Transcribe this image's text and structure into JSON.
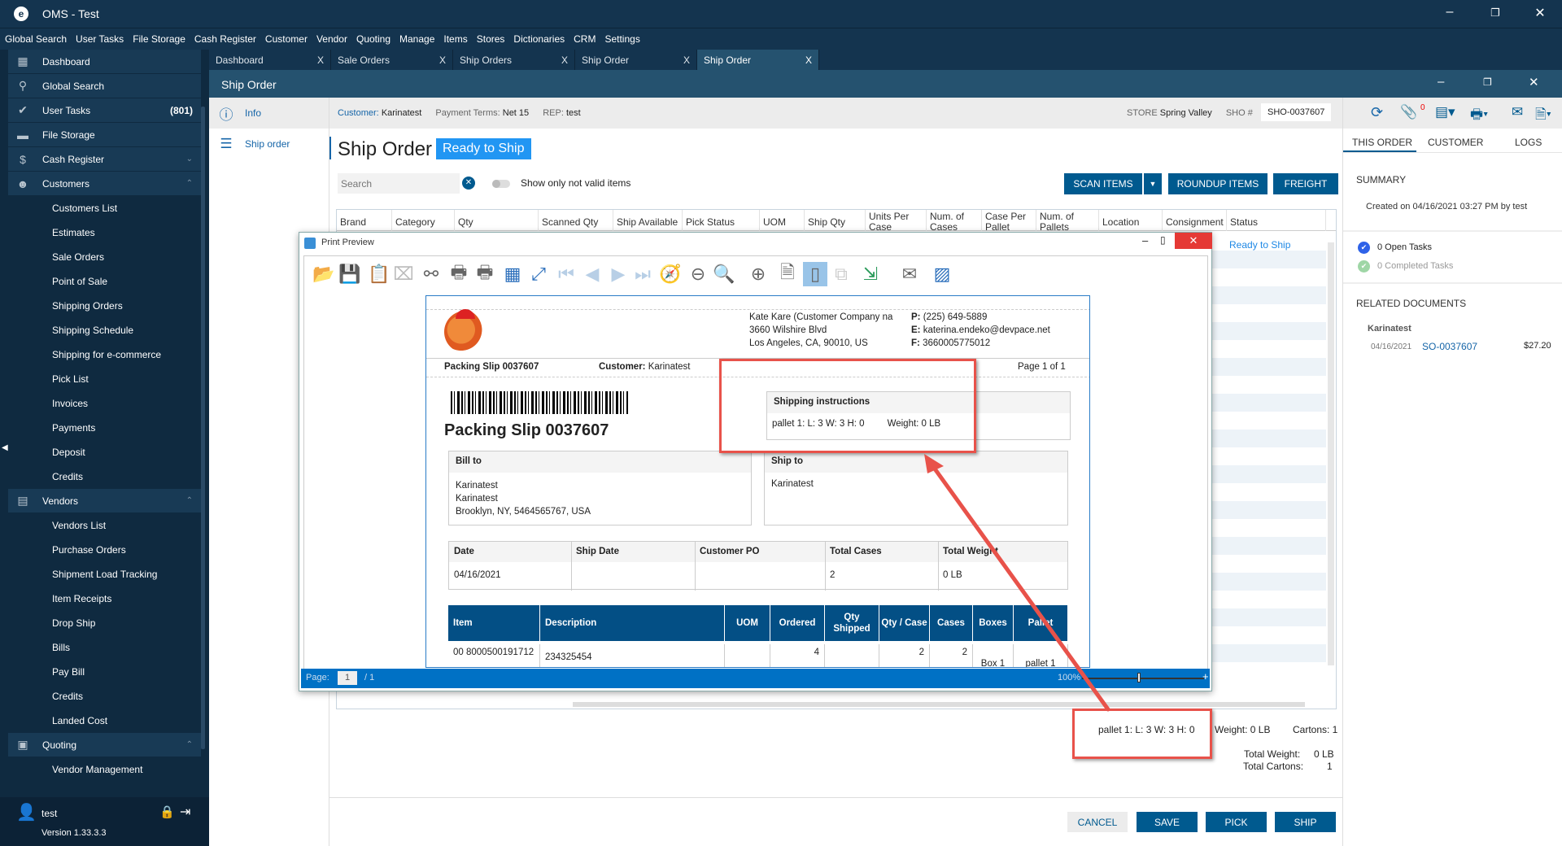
{
  "app": {
    "title": "OMS - Test"
  },
  "menu": [
    "Global Search",
    "User Tasks",
    "File Storage",
    "Cash Register",
    "Customer",
    "Vendor",
    "Quoting",
    "Manage",
    "Items",
    "Stores",
    "Dictionaries",
    "CRM",
    "Settings"
  ],
  "sidebar": {
    "items": [
      {
        "type": "main",
        "label": "Dashboard",
        "icon": "dashboard-icon",
        "glyph": "▦"
      },
      {
        "type": "main",
        "label": "Global Search",
        "icon": "search-icon",
        "glyph": "⚲"
      },
      {
        "type": "main",
        "label": "User Tasks",
        "icon": "check-circle-icon",
        "glyph": "✔",
        "count": "(801)"
      },
      {
        "type": "main",
        "label": "File Storage",
        "icon": "folder-icon",
        "glyph": "▬"
      },
      {
        "type": "main",
        "label": "Cash Register",
        "icon": "dollar-icon",
        "glyph": "$",
        "chev": "⌄"
      },
      {
        "type": "main",
        "label": "Customers",
        "icon": "users-icon",
        "glyph": "☻",
        "chev": "⌃"
      },
      {
        "type": "sub",
        "label": "Customers List"
      },
      {
        "type": "sub",
        "label": "Estimates"
      },
      {
        "type": "sub",
        "label": "Sale Orders"
      },
      {
        "type": "sub",
        "label": "Point of Sale"
      },
      {
        "type": "sub",
        "label": "Shipping Orders"
      },
      {
        "type": "sub",
        "label": "Shipping Schedule"
      },
      {
        "type": "sub",
        "label": "Shipping for e-commerce"
      },
      {
        "type": "sub",
        "label": "Pick List"
      },
      {
        "type": "sub",
        "label": "Invoices"
      },
      {
        "type": "sub",
        "label": "Payments"
      },
      {
        "type": "sub",
        "label": "Deposit"
      },
      {
        "type": "sub",
        "label": "Credits"
      },
      {
        "type": "main",
        "label": "Vendors",
        "icon": "store-icon",
        "glyph": "▤",
        "chev": "⌃"
      },
      {
        "type": "sub",
        "label": "Vendors List"
      },
      {
        "type": "sub",
        "label": "Purchase Orders"
      },
      {
        "type": "sub",
        "label": "Shipment Load Tracking"
      },
      {
        "type": "sub",
        "label": "Item Receipts"
      },
      {
        "type": "sub",
        "label": "Drop Ship"
      },
      {
        "type": "sub",
        "label": "Bills"
      },
      {
        "type": "sub",
        "label": "Pay Bill"
      },
      {
        "type": "sub",
        "label": "Credits"
      },
      {
        "type": "sub",
        "label": "Landed Cost"
      },
      {
        "type": "main",
        "label": "Quoting",
        "icon": "quote-icon",
        "glyph": "▣",
        "chev": "⌃"
      },
      {
        "type": "sub",
        "label": "Vendor Management"
      }
    ],
    "user": "test",
    "version": "Version 1.33.3.3"
  },
  "tabs": [
    {
      "label": "Dashboard"
    },
    {
      "label": "Sale Orders"
    },
    {
      "label": "Ship Orders"
    },
    {
      "label": "Ship Order"
    },
    {
      "label": "Ship Order",
      "active": true
    }
  ],
  "window": {
    "title": "Ship Order"
  },
  "leftnav": {
    "info": "Info",
    "ship_order": "Ship order"
  },
  "infobar": {
    "customer_label": "Customer:",
    "customer": "Karinatest",
    "terms_label": "Payment Terms:",
    "terms": "Net 15",
    "rep_label": "REP:",
    "rep": "test",
    "store_label": "STORE",
    "store": "Spring Valley",
    "sho_label": "SHO #",
    "sho": "SHO-0037607"
  },
  "main": {
    "title": "Ship Order",
    "status": "Ready to Ship",
    "search_placeholder": "Search",
    "toggle_label": "Show only not valid items",
    "scan": "SCAN ITEMS",
    "roundup": "ROUNDUP ITEMS",
    "freight": "FREIGHT",
    "columns": [
      "Brand",
      "Category",
      "Qty",
      "Scanned Qty",
      "Ship Available",
      "Pick Status",
      "UOM",
      "Ship Qty",
      "Units Per Case",
      "Num. of Cases",
      "Case Per Pallet",
      "Num. of Pallets",
      "Location",
      "Consignment",
      "Status"
    ],
    "row_status": "Ready to Ship",
    "pallet": "pallet 1:  L: 3 W: 3 H: 0",
    "weight": "Weight: 0 LB",
    "cartons": "Cartons: 1",
    "total_weight_label": "Total Weight:",
    "total_weight": "0  LB",
    "total_cartons_label": "Total Cartons:",
    "total_cartons": "1",
    "cancel": "CANCEL",
    "save": "SAVE",
    "pick": "PICK",
    "ship": "SHIP"
  },
  "right": {
    "attach_count": "0",
    "tabs": [
      "THIS ORDER",
      "CUSTOMER",
      "LOGS"
    ],
    "summary": "SUMMARY",
    "created": "Created on 04/16/2021 03:27 PM by test",
    "open_tasks": "0 Open Tasks",
    "completed_tasks": "0 Completed Tasks",
    "related": "RELATED DOCUMENTS",
    "rel_customer": "Karinatest",
    "rel_date": "04/16/2021",
    "rel_doc": "SO-0037607",
    "rel_amount": "$27.20"
  },
  "preview": {
    "title": "Print Preview",
    "page_label": "Page:",
    "page": "1",
    "page_total": "/ 1",
    "zoom": "100%",
    "company": [
      "Kate Kare (Customer Company na",
      "3660 Wilshire Blvd",
      "Los Angeles, CA, 90010, US"
    ],
    "contact": [
      {
        "k": "P:",
        "v": "(225) 649-5889"
      },
      {
        "k": "E:",
        "v": "katerina.endeko@devpace.net"
      },
      {
        "k": "F:",
        "v": "3660005775012"
      }
    ],
    "slip_small": "Packing Slip 0037607",
    "customer_label": "Customer:",
    "customer": "Karinatest",
    "page_of": "Page 1 of 1",
    "slip_big": "Packing Slip 0037607",
    "ship_instr_title": "Shipping instructions",
    "ship_instr": "pallet 1:  L: 3 W: 3 H: 0",
    "ship_weight": "Weight: 0 LB",
    "bill_to": "Bill to",
    "bill_lines": [
      "Karinatest",
      "Karinatest",
      "Brooklyn, NY, 5464565767, USA"
    ],
    "ship_to": "Ship to",
    "ship_lines": [
      "Karinatest"
    ],
    "info_headers": [
      "Date",
      "Ship Date",
      "Customer PO",
      "Total Cases",
      "Total Weight"
    ],
    "info_values": [
      "04/16/2021",
      "",
      "",
      "2",
      "0 LB"
    ],
    "item_headers": [
      "Item",
      "Description",
      "UOM",
      "Ordered",
      "Qty Shipped",
      "Qty / Case",
      "Cases",
      "Boxes",
      "Pallet"
    ],
    "item_row": [
      "00 8000500191712",
      "234325454",
      "",
      "4",
      "",
      "2",
      "2",
      "Box 1",
      "pallet 1"
    ]
  },
  "colors": {
    "accent": "#005a8f",
    "status": "#2196f3",
    "annotation": "#e8524a",
    "table_header": "#034f85"
  }
}
